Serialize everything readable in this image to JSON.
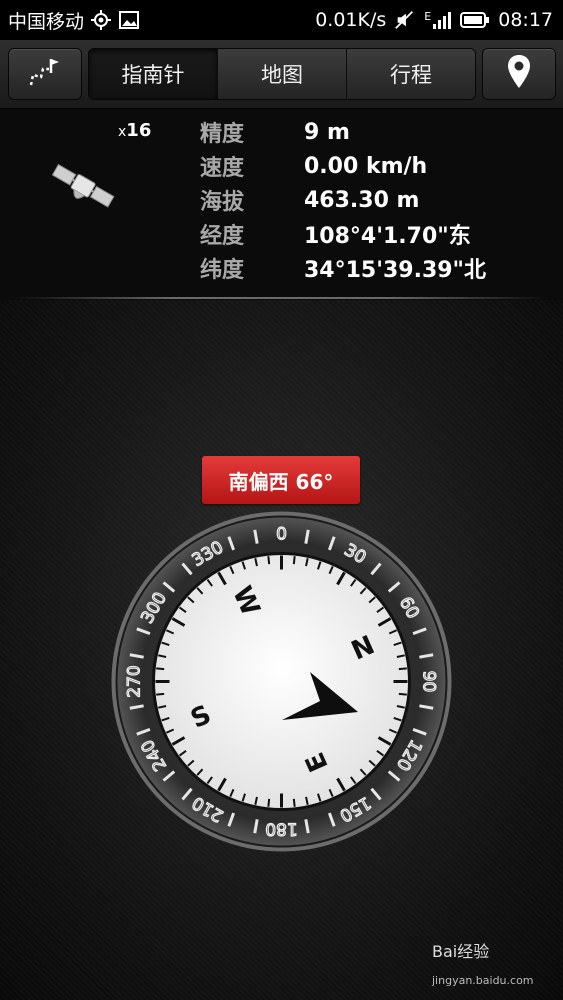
{
  "status_bar": {
    "carrier": "中国移动",
    "net_speed": "0.01K/s",
    "net_type": "E",
    "time": "08:17",
    "icons": [
      "gps-icon",
      "image-icon",
      "mute-icon",
      "signal-icon",
      "battery-icon"
    ]
  },
  "toolbar": {
    "route_button_icon": "route-flag-icon",
    "tabs": [
      {
        "label": "指南针",
        "active": true
      },
      {
        "label": "地图",
        "active": false
      },
      {
        "label": "行程",
        "active": false
      }
    ],
    "location_button_icon": "location-pin-icon"
  },
  "gps": {
    "satellite_prefix": "x",
    "satellite_count": "16",
    "rows": [
      {
        "label": "精度",
        "value": "9 m"
      },
      {
        "label": "速度",
        "value": "0.00 km/h"
      },
      {
        "label": "海拔",
        "value": "463.30 m"
      },
      {
        "label": "经度",
        "value": "108°4'1.70\"东"
      },
      {
        "label": "纬度",
        "value": "34°15'39.39\"北"
      }
    ]
  },
  "compass": {
    "heading_text": "南偏西 66°",
    "bezel_labels": [
      "0",
      "30",
      "60",
      "90",
      "120",
      "150",
      "180",
      "210",
      "240",
      "270",
      "300",
      "330"
    ],
    "dial_letters": {
      "north": "N",
      "east": "E",
      "south": "S",
      "west": "W"
    },
    "accent_color": "#d42525"
  },
  "watermark": {
    "brand": "Bai经验",
    "url": "jingyan.baidu.com"
  }
}
